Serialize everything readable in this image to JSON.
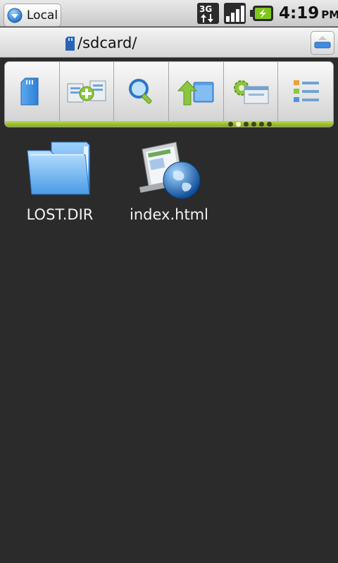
{
  "status_bar": {
    "network_label": "3G",
    "time": "4:19",
    "ampm": "PM",
    "icons": [
      "3g-data-icon",
      "signal-strength-icon",
      "battery-charging-icon"
    ]
  },
  "path_bar": {
    "location_button_label": "Local",
    "current_path": "/sdcard/"
  },
  "toolbar": {
    "buttons": [
      {
        "name": "sdcard-button",
        "icon": "sdcard-icon"
      },
      {
        "name": "new-file-button",
        "icon": "add-files-icon"
      },
      {
        "name": "search-button",
        "icon": "magnifier-icon"
      },
      {
        "name": "up-directory-button",
        "icon": "folder-up-icon"
      },
      {
        "name": "settings-button",
        "icon": "gear-window-icon"
      },
      {
        "name": "view-mode-button",
        "icon": "list-view-icon"
      }
    ],
    "page_count": 6,
    "active_page": 2,
    "accent_color": "#9cc524"
  },
  "files": [
    {
      "name": "LOST.DIR",
      "type": "folder",
      "icon": "folder-icon"
    },
    {
      "name": "index.html",
      "type": "html",
      "icon": "web-page-globe-icon"
    }
  ]
}
